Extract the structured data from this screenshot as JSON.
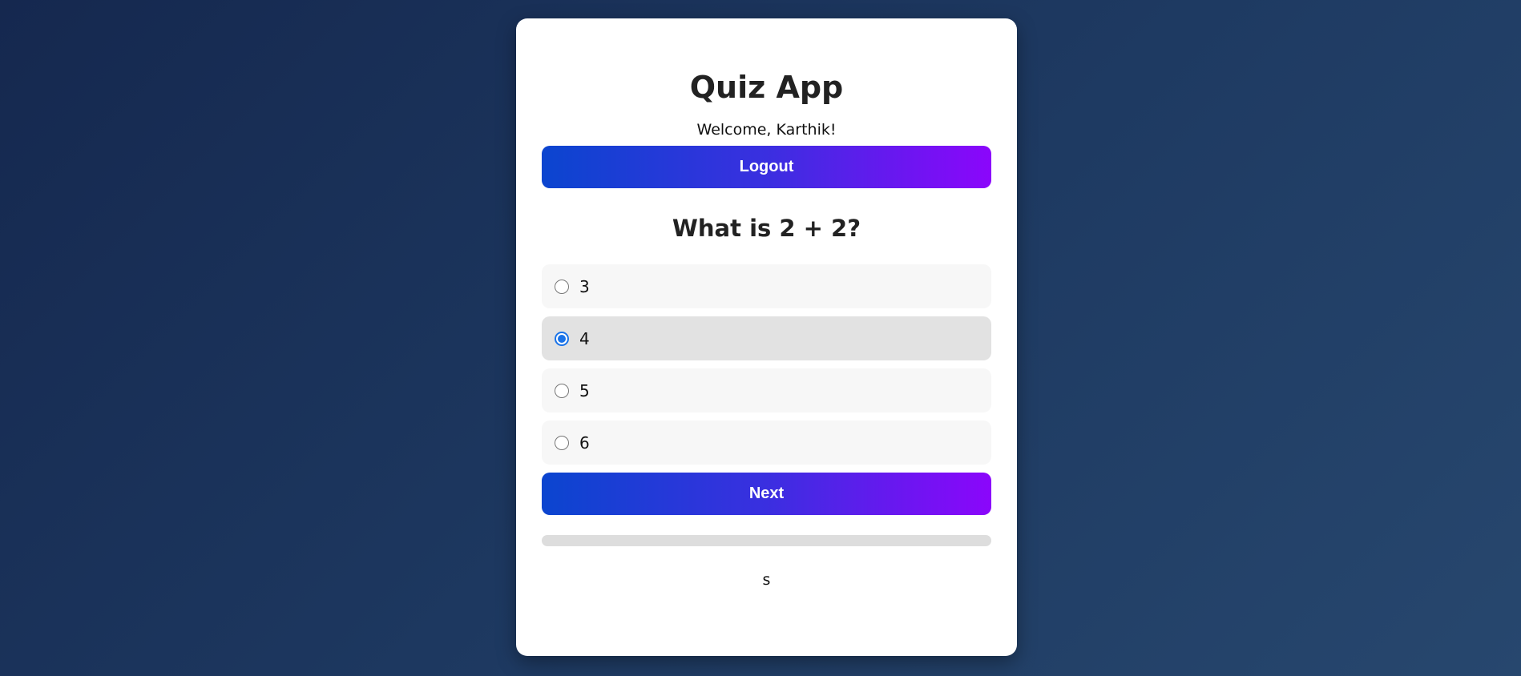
{
  "app": {
    "title": "Quiz App",
    "welcome": "Welcome, Karthik!"
  },
  "buttons": {
    "logout_label": "Logout",
    "next_label": "Next"
  },
  "quiz": {
    "question": "What is 2 + 2?",
    "options": [
      {
        "label": "3",
        "selected": false
      },
      {
        "label": "4",
        "selected": true
      },
      {
        "label": "5",
        "selected": false
      },
      {
        "label": "6",
        "selected": false
      }
    ],
    "progress_percent": 0,
    "status_text": "s"
  },
  "colors": {
    "gradient_start": "#0b45cf",
    "gradient_end": "#8b06fb",
    "radio_checked": "#1a73e8"
  }
}
